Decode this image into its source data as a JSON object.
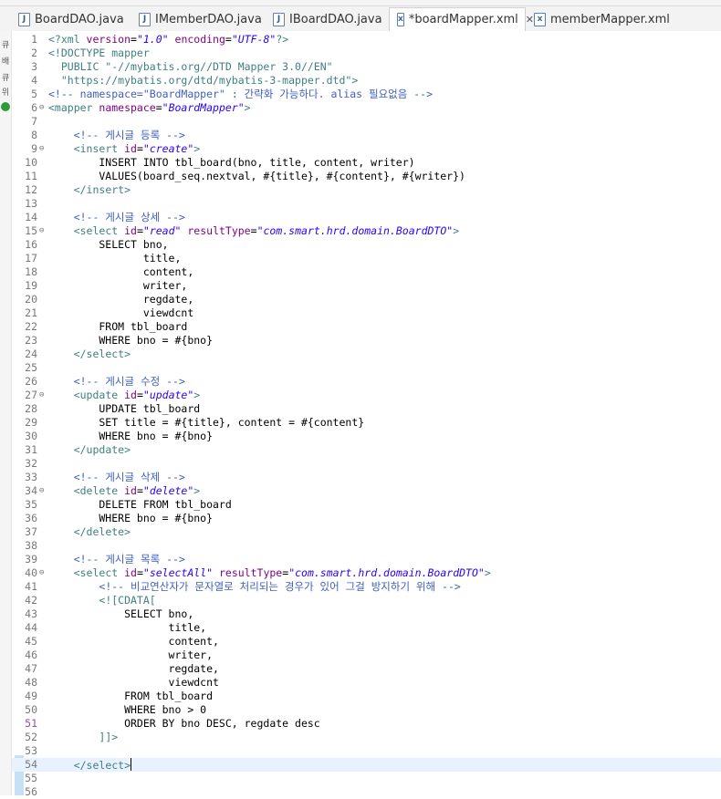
{
  "tabs": [
    {
      "label": "BoardDAO.java",
      "icon": "java-file-icon",
      "active": false
    },
    {
      "label": "IMemberDAO.java",
      "icon": "java-file-icon",
      "active": false
    },
    {
      "label": "IBoardDAO.java",
      "icon": "java-file-icon",
      "active": false
    },
    {
      "label": "*boardMapper.xml",
      "icon": "xml-file-icon",
      "active": true
    },
    {
      "label": "memberMapper.xml",
      "icon": "xml-file-icon",
      "active": false
    }
  ],
  "close_glyph": "✕",
  "trim_labels": [
    "큐",
    "배",
    "큐",
    "위"
  ],
  "colors": {
    "tag": "#3f7f7f",
    "attr": "#7f007f",
    "value": "#2a00ff",
    "comment": "#3f5fbf"
  },
  "current_line": 54,
  "modified_line": 51,
  "code_lines": [
    {
      "n": "1",
      "fold": "",
      "segs": [
        [
          "pi",
          "<?xml "
        ],
        [
          "attr",
          "version"
        ],
        [
          "txt",
          "="
        ],
        [
          "val",
          "\"1.0\""
        ],
        [
          "txt",
          " "
        ],
        [
          "attr",
          "encoding"
        ],
        [
          "txt",
          "="
        ],
        [
          "val",
          "\"UTF-8\""
        ],
        [
          "pi",
          "?>"
        ]
      ]
    },
    {
      "n": "2",
      "fold": "",
      "segs": [
        [
          "tag",
          "<!DOCTYPE mapper"
        ]
      ]
    },
    {
      "n": "3",
      "fold": "",
      "segs": [
        [
          "tag",
          "  PUBLIC \"-//mybatis.org//DTD Mapper 3.0//EN\""
        ]
      ]
    },
    {
      "n": "4",
      "fold": "",
      "segs": [
        [
          "tag",
          "  \"https://mybatis.org/dtd/mybatis-3-mapper.dtd\">"
        ]
      ]
    },
    {
      "n": "5",
      "fold": "",
      "segs": [
        [
          "com",
          "<!-- namespace=\"BoardMapper\" : 간략화 가능하다. alias 필요없음 -->"
        ]
      ]
    },
    {
      "n": "6",
      "fold": "⊖",
      "segs": [
        [
          "tag",
          "<mapper "
        ],
        [
          "attr",
          "namespace"
        ],
        [
          "txt",
          "="
        ],
        [
          "val",
          "\"BoardMapper\""
        ],
        [
          "tag",
          ">"
        ]
      ]
    },
    {
      "n": "7",
      "fold": "",
      "segs": []
    },
    {
      "n": "8",
      "fold": "",
      "segs": [
        [
          "txt",
          "    "
        ],
        [
          "com",
          "<!-- 게시글 등록 -->"
        ]
      ]
    },
    {
      "n": "9",
      "fold": "⊖",
      "segs": [
        [
          "txt",
          "    "
        ],
        [
          "tag",
          "<insert "
        ],
        [
          "attr",
          "id"
        ],
        [
          "txt",
          "="
        ],
        [
          "val",
          "\"create\""
        ],
        [
          "tag",
          ">"
        ]
      ]
    },
    {
      "n": "10",
      "fold": "",
      "segs": [
        [
          "txt",
          "        INSERT INTO tbl_board(bno, title, content, writer)"
        ]
      ]
    },
    {
      "n": "11",
      "fold": "",
      "segs": [
        [
          "txt",
          "        VALUES(board_seq.nextval, #{title}, #{content}, #{writer})"
        ]
      ]
    },
    {
      "n": "12",
      "fold": "",
      "segs": [
        [
          "txt",
          "    "
        ],
        [
          "tag",
          "</insert>"
        ]
      ]
    },
    {
      "n": "13",
      "fold": "",
      "segs": []
    },
    {
      "n": "14",
      "fold": "",
      "segs": [
        [
          "txt",
          "    "
        ],
        [
          "com",
          "<!-- 게시글 상세 -->"
        ]
      ]
    },
    {
      "n": "15",
      "fold": "⊖",
      "segs": [
        [
          "txt",
          "    "
        ],
        [
          "tag",
          "<select "
        ],
        [
          "attr",
          "id"
        ],
        [
          "txt",
          "="
        ],
        [
          "val",
          "\"read\""
        ],
        [
          "txt",
          " "
        ],
        [
          "attr",
          "resultType"
        ],
        [
          "txt",
          "="
        ],
        [
          "val",
          "\"com.smart.hrd.domain.BoardDTO\""
        ],
        [
          "tag",
          ">"
        ]
      ]
    },
    {
      "n": "16",
      "fold": "",
      "segs": [
        [
          "txt",
          "        SELECT bno,"
        ]
      ]
    },
    {
      "n": "17",
      "fold": "",
      "segs": [
        [
          "txt",
          "               title,"
        ]
      ]
    },
    {
      "n": "18",
      "fold": "",
      "segs": [
        [
          "txt",
          "               content,"
        ]
      ]
    },
    {
      "n": "19",
      "fold": "",
      "segs": [
        [
          "txt",
          "               writer,"
        ]
      ]
    },
    {
      "n": "20",
      "fold": "",
      "segs": [
        [
          "txt",
          "               regdate,"
        ]
      ]
    },
    {
      "n": "21",
      "fold": "",
      "segs": [
        [
          "txt",
          "               viewdcnt"
        ]
      ]
    },
    {
      "n": "22",
      "fold": "",
      "segs": [
        [
          "txt",
          "        FROM tbl_board"
        ]
      ]
    },
    {
      "n": "23",
      "fold": "",
      "segs": [
        [
          "txt",
          "        WHERE bno = #{bno}"
        ]
      ]
    },
    {
      "n": "24",
      "fold": "",
      "segs": [
        [
          "txt",
          "    "
        ],
        [
          "tag",
          "</select>"
        ]
      ]
    },
    {
      "n": "25",
      "fold": "",
      "segs": []
    },
    {
      "n": "26",
      "fold": "",
      "segs": [
        [
          "txt",
          "    "
        ],
        [
          "com",
          "<!-- 게시글 수정 -->"
        ]
      ]
    },
    {
      "n": "27",
      "fold": "⊖",
      "segs": [
        [
          "txt",
          "    "
        ],
        [
          "tag",
          "<update "
        ],
        [
          "attr",
          "id"
        ],
        [
          "txt",
          "="
        ],
        [
          "val",
          "\"update\""
        ],
        [
          "tag",
          ">"
        ]
      ]
    },
    {
      "n": "28",
      "fold": "",
      "segs": [
        [
          "txt",
          "        UPDATE tbl_board"
        ]
      ]
    },
    {
      "n": "29",
      "fold": "",
      "segs": [
        [
          "txt",
          "        SET title = #{title}, content = #{content}"
        ]
      ]
    },
    {
      "n": "30",
      "fold": "",
      "segs": [
        [
          "txt",
          "        WHERE bno = #{bno}"
        ]
      ]
    },
    {
      "n": "31",
      "fold": "",
      "segs": [
        [
          "txt",
          "    "
        ],
        [
          "tag",
          "</update>"
        ]
      ]
    },
    {
      "n": "32",
      "fold": "",
      "segs": []
    },
    {
      "n": "33",
      "fold": "",
      "segs": [
        [
          "txt",
          "    "
        ],
        [
          "com",
          "<!-- 게시글 삭제 -->"
        ]
      ]
    },
    {
      "n": "34",
      "fold": "⊖",
      "segs": [
        [
          "txt",
          "    "
        ],
        [
          "tag",
          "<delete "
        ],
        [
          "attr",
          "id"
        ],
        [
          "txt",
          "="
        ],
        [
          "val",
          "\"delete\""
        ],
        [
          "tag",
          ">"
        ]
      ]
    },
    {
      "n": "35",
      "fold": "",
      "segs": [
        [
          "txt",
          "        DELETE FROM tbl_board"
        ]
      ]
    },
    {
      "n": "36",
      "fold": "",
      "segs": [
        [
          "txt",
          "        WHERE bno = #{bno}"
        ]
      ]
    },
    {
      "n": "37",
      "fold": "",
      "segs": [
        [
          "txt",
          "    "
        ],
        [
          "tag",
          "</delete>"
        ]
      ]
    },
    {
      "n": "38",
      "fold": "",
      "segs": []
    },
    {
      "n": "39",
      "fold": "",
      "segs": [
        [
          "txt",
          "    "
        ],
        [
          "com",
          "<!-- 게시글 목록 -->"
        ]
      ]
    },
    {
      "n": "40",
      "fold": "⊖",
      "segs": [
        [
          "txt",
          "    "
        ],
        [
          "tag",
          "<select "
        ],
        [
          "attr",
          "id"
        ],
        [
          "txt",
          "="
        ],
        [
          "val",
          "\"selectAll\""
        ],
        [
          "txt",
          " "
        ],
        [
          "attr",
          "resultType"
        ],
        [
          "txt",
          "="
        ],
        [
          "val",
          "\"com.smart.hrd.domain.BoardDTO\""
        ],
        [
          "tag",
          ">"
        ]
      ]
    },
    {
      "n": "41",
      "fold": "",
      "segs": [
        [
          "txt",
          "        "
        ],
        [
          "com",
          "<!-- 비교연산자가 문자열로 처리되는 경우가 있어 그걸 방지하기 위해 -->"
        ]
      ]
    },
    {
      "n": "42",
      "fold": "",
      "segs": [
        [
          "txt",
          "        "
        ],
        [
          "tag",
          "<![CDATA["
        ]
      ]
    },
    {
      "n": "43",
      "fold": "",
      "segs": [
        [
          "txt",
          "            SELECT bno,"
        ]
      ]
    },
    {
      "n": "44",
      "fold": "",
      "segs": [
        [
          "txt",
          "                   title,"
        ]
      ]
    },
    {
      "n": "45",
      "fold": "",
      "segs": [
        [
          "txt",
          "                   content,"
        ]
      ]
    },
    {
      "n": "46",
      "fold": "",
      "segs": [
        [
          "txt",
          "                   writer,"
        ]
      ]
    },
    {
      "n": "47",
      "fold": "",
      "segs": [
        [
          "txt",
          "                   regdate,"
        ]
      ]
    },
    {
      "n": "48",
      "fold": "",
      "segs": [
        [
          "txt",
          "                   viewdcnt"
        ]
      ]
    },
    {
      "n": "49",
      "fold": "",
      "segs": [
        [
          "txt",
          "            FROM tbl_board"
        ]
      ]
    },
    {
      "n": "50",
      "fold": "",
      "segs": [
        [
          "txt",
          "            WHERE bno > 0"
        ]
      ]
    },
    {
      "n": "51",
      "fold": "",
      "segs": [
        [
          "txt",
          "            ORDER BY bno DESC, regdate desc"
        ]
      ]
    },
    {
      "n": "52",
      "fold": "",
      "segs": [
        [
          "txt",
          "        "
        ],
        [
          "tag",
          "]]>"
        ]
      ]
    },
    {
      "n": "53",
      "fold": "",
      "segs": []
    },
    {
      "n": "54",
      "fold": "",
      "segs": [
        [
          "txt",
          "    "
        ],
        [
          "tag",
          "</select>"
        ]
      ]
    },
    {
      "n": "55",
      "fold": "",
      "segs": []
    },
    {
      "n": "56",
      "fold": "",
      "segs": []
    }
  ]
}
